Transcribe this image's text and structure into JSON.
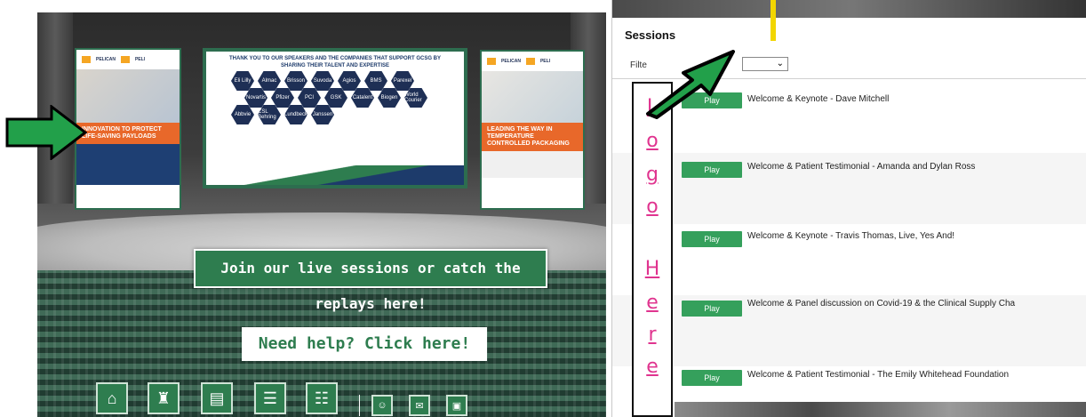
{
  "auditorium": {
    "screen_heading": "THANK YOU TO OUR SPEAKERS AND THE COMPANIES THAT SUPPORT GCSG BY SHARING THEIR TALENT AND EXPERTISE",
    "companies": [
      "Eli Lilly",
      "Almac",
      "Brisson",
      "Suvoda",
      "Agios",
      "BMS",
      "Parexel",
      "Novartis",
      "Pfizer",
      "PCI",
      "GSK",
      "Catalent",
      "Biogen",
      "World Courier",
      "Abbvie",
      "CSL Behring",
      "Lundbeck",
      "Janssen"
    ],
    "left_banner": {
      "brand_1": "PELICAN",
      "brand_2": "PELI",
      "tagline": "INNOVATION TO PROTECT LIFE-SAVING PAYLOADS"
    },
    "right_banner": {
      "brand_1": "PELICAN",
      "brand_2": "PELI",
      "tagline": "LEADING THE WAY IN TEMPERATURE CONTROLLED PACKAGING"
    },
    "live_sessions_button": "Join our live sessions or catch the replays here!",
    "help_button": "Need help?  Click here!",
    "nav_icons": [
      "home-icon",
      "auditorium-icon",
      "exhibit-icon",
      "library-icon",
      "networking-icon",
      "people-icon",
      "chat-icon",
      "briefcase-icon"
    ]
  },
  "sessions_panel": {
    "title": "Sessions",
    "filter_label": "Filte",
    "filter_value": "",
    "play_label": "Play",
    "sessions": [
      {
        "title": "Welcome & Keynote - Dave Mitchell"
      },
      {
        "title": "Welcome & Patient Testimonial - Amanda and Dylan Ross"
      },
      {
        "title": "Welcome & Keynote - Travis Thomas, Live, Yes And!"
      },
      {
        "title": "Welcome & Panel discussion on Covid-19 & the Clinical Supply Cha"
      },
      {
        "title": "Welcome & Patient Testimonial - The Emily Whitehead Foundation"
      }
    ],
    "logo_placeholder": [
      "L",
      "o",
      "g",
      "o",
      "",
      "H",
      "e",
      "r",
      "e"
    ]
  },
  "colors": {
    "accent_green": "#2e7d4f",
    "play_green": "#35a05c",
    "arrow_green": "#22a04a",
    "logo_pink": "#e0348f",
    "banner_orange": "#e8682a"
  }
}
